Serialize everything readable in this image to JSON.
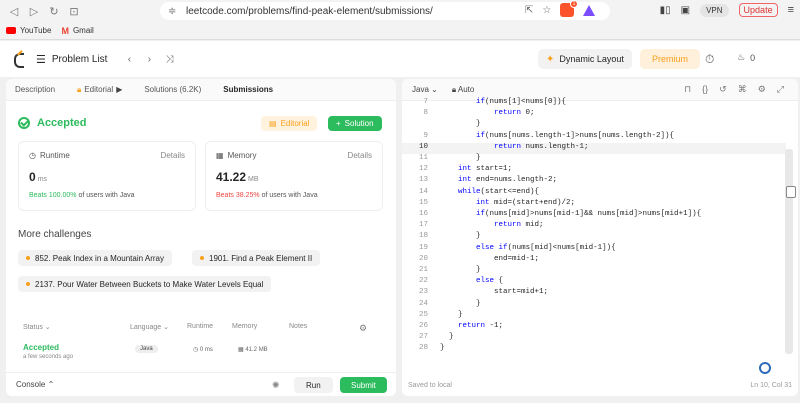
{
  "browser": {
    "url": "leetcode.com/problems/find-peak-element/submissions/",
    "brave_badge": "1",
    "vpn": "VPN",
    "update": "Update",
    "bookmarks": [
      {
        "label": "YouTube",
        "icon": "youtube-icon"
      },
      {
        "label": "Gmail",
        "icon": "gmail-icon"
      }
    ]
  },
  "top": {
    "problem_list": "Problem List",
    "dynamic_layout": "Dynamic Layout",
    "premium": "Premium",
    "streak": "0"
  },
  "tabs": [
    {
      "label": "Description"
    },
    {
      "label": "Editorial"
    },
    {
      "label": "Solutions (6.2K)"
    },
    {
      "label": "Submissions"
    }
  ],
  "result": {
    "status": "Accepted",
    "editorial_btn": "Editorial",
    "solution_btn": "Solution",
    "runtime": {
      "title": "Runtime",
      "details": "Details",
      "value": "0",
      "unit": "ms",
      "beats_label": "Beats",
      "beats_pct": "100.00%",
      "beats_suffix": "of users with Java"
    },
    "memory": {
      "title": "Memory",
      "details": "Details",
      "value": "41.22",
      "unit": "MB",
      "beats_label": "Beats",
      "beats_pct": "38.25%",
      "beats_suffix": "of users with Java"
    }
  },
  "more": {
    "title": "More challenges",
    "items": [
      "852. Peak Index in a Mountain Array",
      "1901. Find a Peak Element II",
      "2137. Pour Water Between Buckets to Make Water Levels Equal"
    ]
  },
  "submissions": {
    "columns": [
      "Status",
      "Language",
      "Runtime",
      "Memory",
      "Notes"
    ],
    "row": {
      "status": "Accepted",
      "ago": "a few seconds ago",
      "language": "Java",
      "runtime": "0 ms",
      "memory": "41.2 MB"
    }
  },
  "bottom": {
    "console": "Console",
    "run": "Run",
    "submit": "Submit"
  },
  "editor": {
    "language": "Java",
    "mode": "Auto",
    "footer_left": "Saved to local",
    "footer_right": "Ln 10, Col 31",
    "lines": [
      {
        "n": "7",
        "text": "        if(nums[1]<nums[0]){"
      },
      {
        "n": "8",
        "text": "            return 0;"
      },
      {
        "n": "",
        "text": "        }"
      },
      {
        "n": "9",
        "text": "        if(nums[nums.length-1]>nums[nums.length-2]){"
      },
      {
        "n": "10",
        "text": "            return nums.length-1;"
      },
      {
        "n": "11",
        "text": "        }"
      },
      {
        "n": "12",
        "text": "    int start=1;"
      },
      {
        "n": "13",
        "text": "    int end=nums.length-2;"
      },
      {
        "n": "14",
        "text": "    while(start<=end){"
      },
      {
        "n": "15",
        "text": "        int mid=(start+end)/2;"
      },
      {
        "n": "16",
        "text": "        if(nums[mid]>nums[mid-1]&& nums[mid]>nums[mid+1]){"
      },
      {
        "n": "17",
        "text": "            return mid;"
      },
      {
        "n": "18",
        "text": "        }"
      },
      {
        "n": "19",
        "text": "        else if(nums[mid]<nums[mid-1]){"
      },
      {
        "n": "20",
        "text": "            end=mid-1;"
      },
      {
        "n": "21",
        "text": "        }"
      },
      {
        "n": "22",
        "text": "        else {"
      },
      {
        "n": "23",
        "text": "            start=mid+1;"
      },
      {
        "n": "24",
        "text": "        }"
      },
      {
        "n": "25",
        "text": "    }"
      },
      {
        "n": "26",
        "text": "    return -1;"
      },
      {
        "n": "27",
        "text": "  }"
      },
      {
        "n": "28",
        "text": "}"
      }
    ]
  },
  "colors": {
    "accent_green": "#2cbb5d",
    "accent_orange": "#f89f1b",
    "red": "#ef4743"
  }
}
